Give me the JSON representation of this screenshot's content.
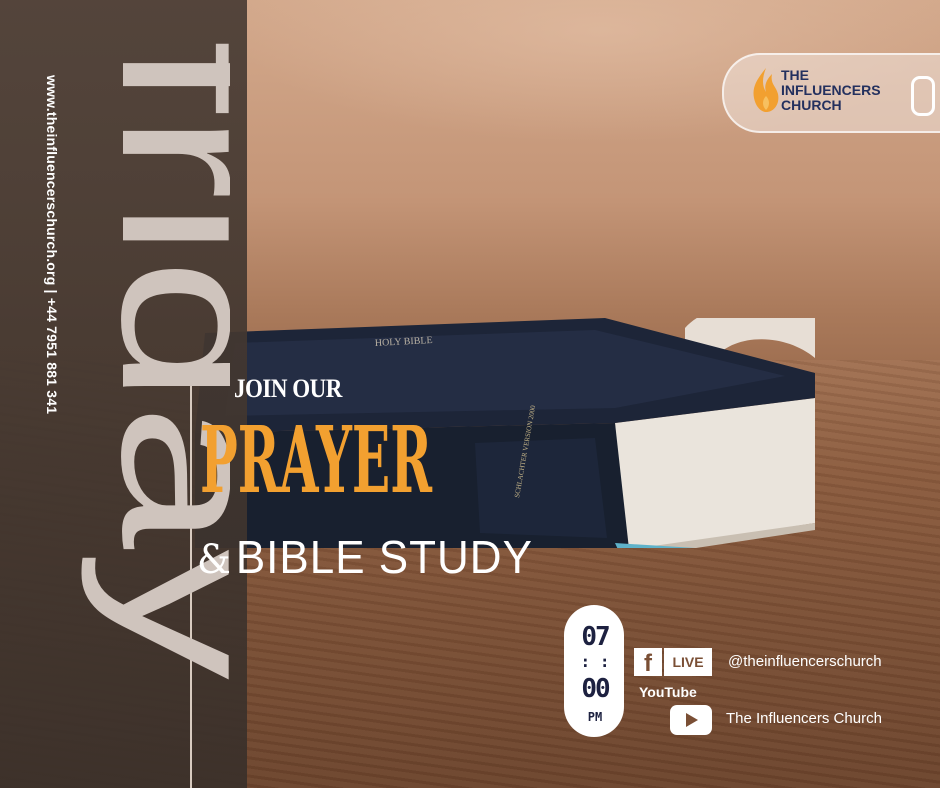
{
  "background": {
    "accent": "#f2a030",
    "panel": "#3a302a",
    "text": "#ffffff"
  },
  "day": "friday",
  "contact": "www.theinfluencerschurch.org | +44 7951 881 341",
  "logo": {
    "line1": "THE",
    "line2": "INFLUENCERS",
    "line3": "CHURCH",
    "icon": "flame-icon",
    "color": "#23305e"
  },
  "headline": {
    "join": "JOIN OUR",
    "prayer": "PRAYER",
    "ampersand": "&",
    "subtitle": "BIBLE STUDY"
  },
  "time": {
    "hour": "07",
    "minute": "00",
    "ampm": "PM"
  },
  "social": {
    "facebook": {
      "icon": "facebook-icon",
      "live": "LIVE",
      "handle": "@theinfluencerschurch"
    },
    "youtube": {
      "label": "YouTube",
      "icon": "youtube-icon",
      "channel": "The Influencers Church"
    }
  }
}
